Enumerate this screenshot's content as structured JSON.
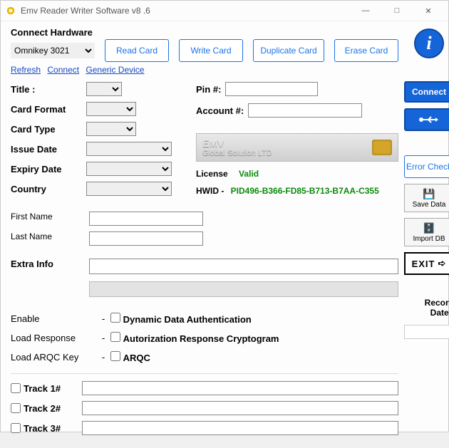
{
  "window": {
    "title": "Emv Reader Writer Software v8 .6"
  },
  "hardware": {
    "section_label": "Connect Hardware",
    "device_selected": "Omnikey 3021",
    "links": {
      "refresh": "Refresh",
      "connect": "Connect",
      "generic": "Generic Device"
    }
  },
  "actions": {
    "read": "Read Card",
    "write": "Write Card",
    "duplicate": "Duplicate Card",
    "erase": "Erase Card"
  },
  "fields": {
    "title_lbl": "Title :",
    "pin_lbl": "Pin #:",
    "card_format_lbl": "Card Format",
    "account_lbl": "Account #:",
    "card_type_lbl": "Card Type",
    "issue_date_lbl": "Issue Date",
    "expiry_date_lbl": "Expiry Date",
    "country_lbl": "Country",
    "first_name_lbl": "First Name",
    "last_name_lbl": "Last Name",
    "extra_info_lbl": "Extra Info"
  },
  "brand": {
    "line1": "EMV",
    "line2": "Global Solution LTD"
  },
  "license": {
    "label": "License",
    "status": "Valid",
    "hwid_label": "HWID -",
    "hwid_value": "PID496-B366-FD85-B713-B7AA-C355"
  },
  "checks": {
    "enable_lbl": "Enable",
    "dda_lbl": "Dynamic Data Authentication",
    "load_response_lbl": "Load Response",
    "arc_lbl": "Autorization Response Cryptogram",
    "load_arqc_lbl": "Load ARQC Key",
    "arqc_lbl": "ARQC"
  },
  "tracks": {
    "t1": "Track 1#",
    "t2": "Track 2#",
    "t3": "Track 3#"
  },
  "side": {
    "connect": "Connect",
    "error_check": "Error Check",
    "save_data": "Save Data",
    "import_db": "Import DB",
    "exit": "EXIT",
    "record_date": "Record Date :"
  }
}
